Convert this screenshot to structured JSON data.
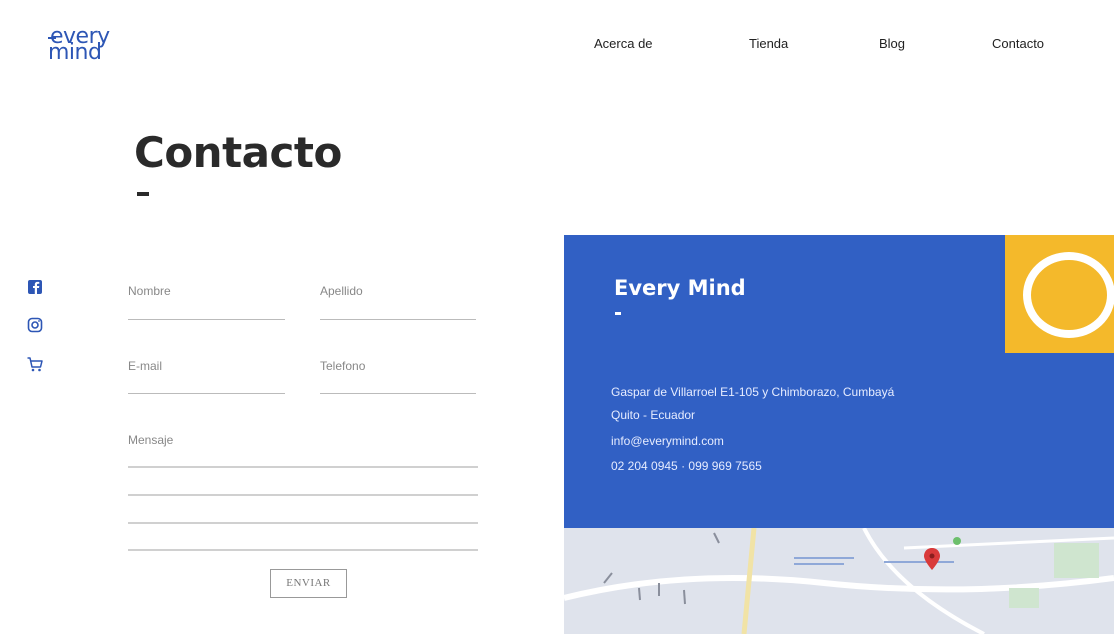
{
  "header": {
    "logo_top": "every",
    "logo_bottom": "mind",
    "nav": [
      "Acerca de",
      "Tienda",
      "Blog",
      "Contacto"
    ]
  },
  "page": {
    "title": "Contacto"
  },
  "social": [
    "facebook-icon",
    "instagram-icon",
    "cart-icon"
  ],
  "form": {
    "nombre_label": "Nombre",
    "apellido_label": "Apellido",
    "email_label": "E-mail",
    "telefono_label": "Telefono",
    "mensaje_label": "Mensaje",
    "submit_label": "ENVIAR"
  },
  "info": {
    "name": "Every Mind",
    "address": "Gaspar de Villarroel E1-105 y Chimborazo, Cumbayá",
    "city": "Quito - Ecuador",
    "email": "info@everymind.com",
    "phones": "02 204 0945 · 099 969 7565"
  },
  "colors": {
    "brand_blue": "#3160c4",
    "accent_yellow": "#f4b92b",
    "logo_blue": "#2d56b5"
  }
}
